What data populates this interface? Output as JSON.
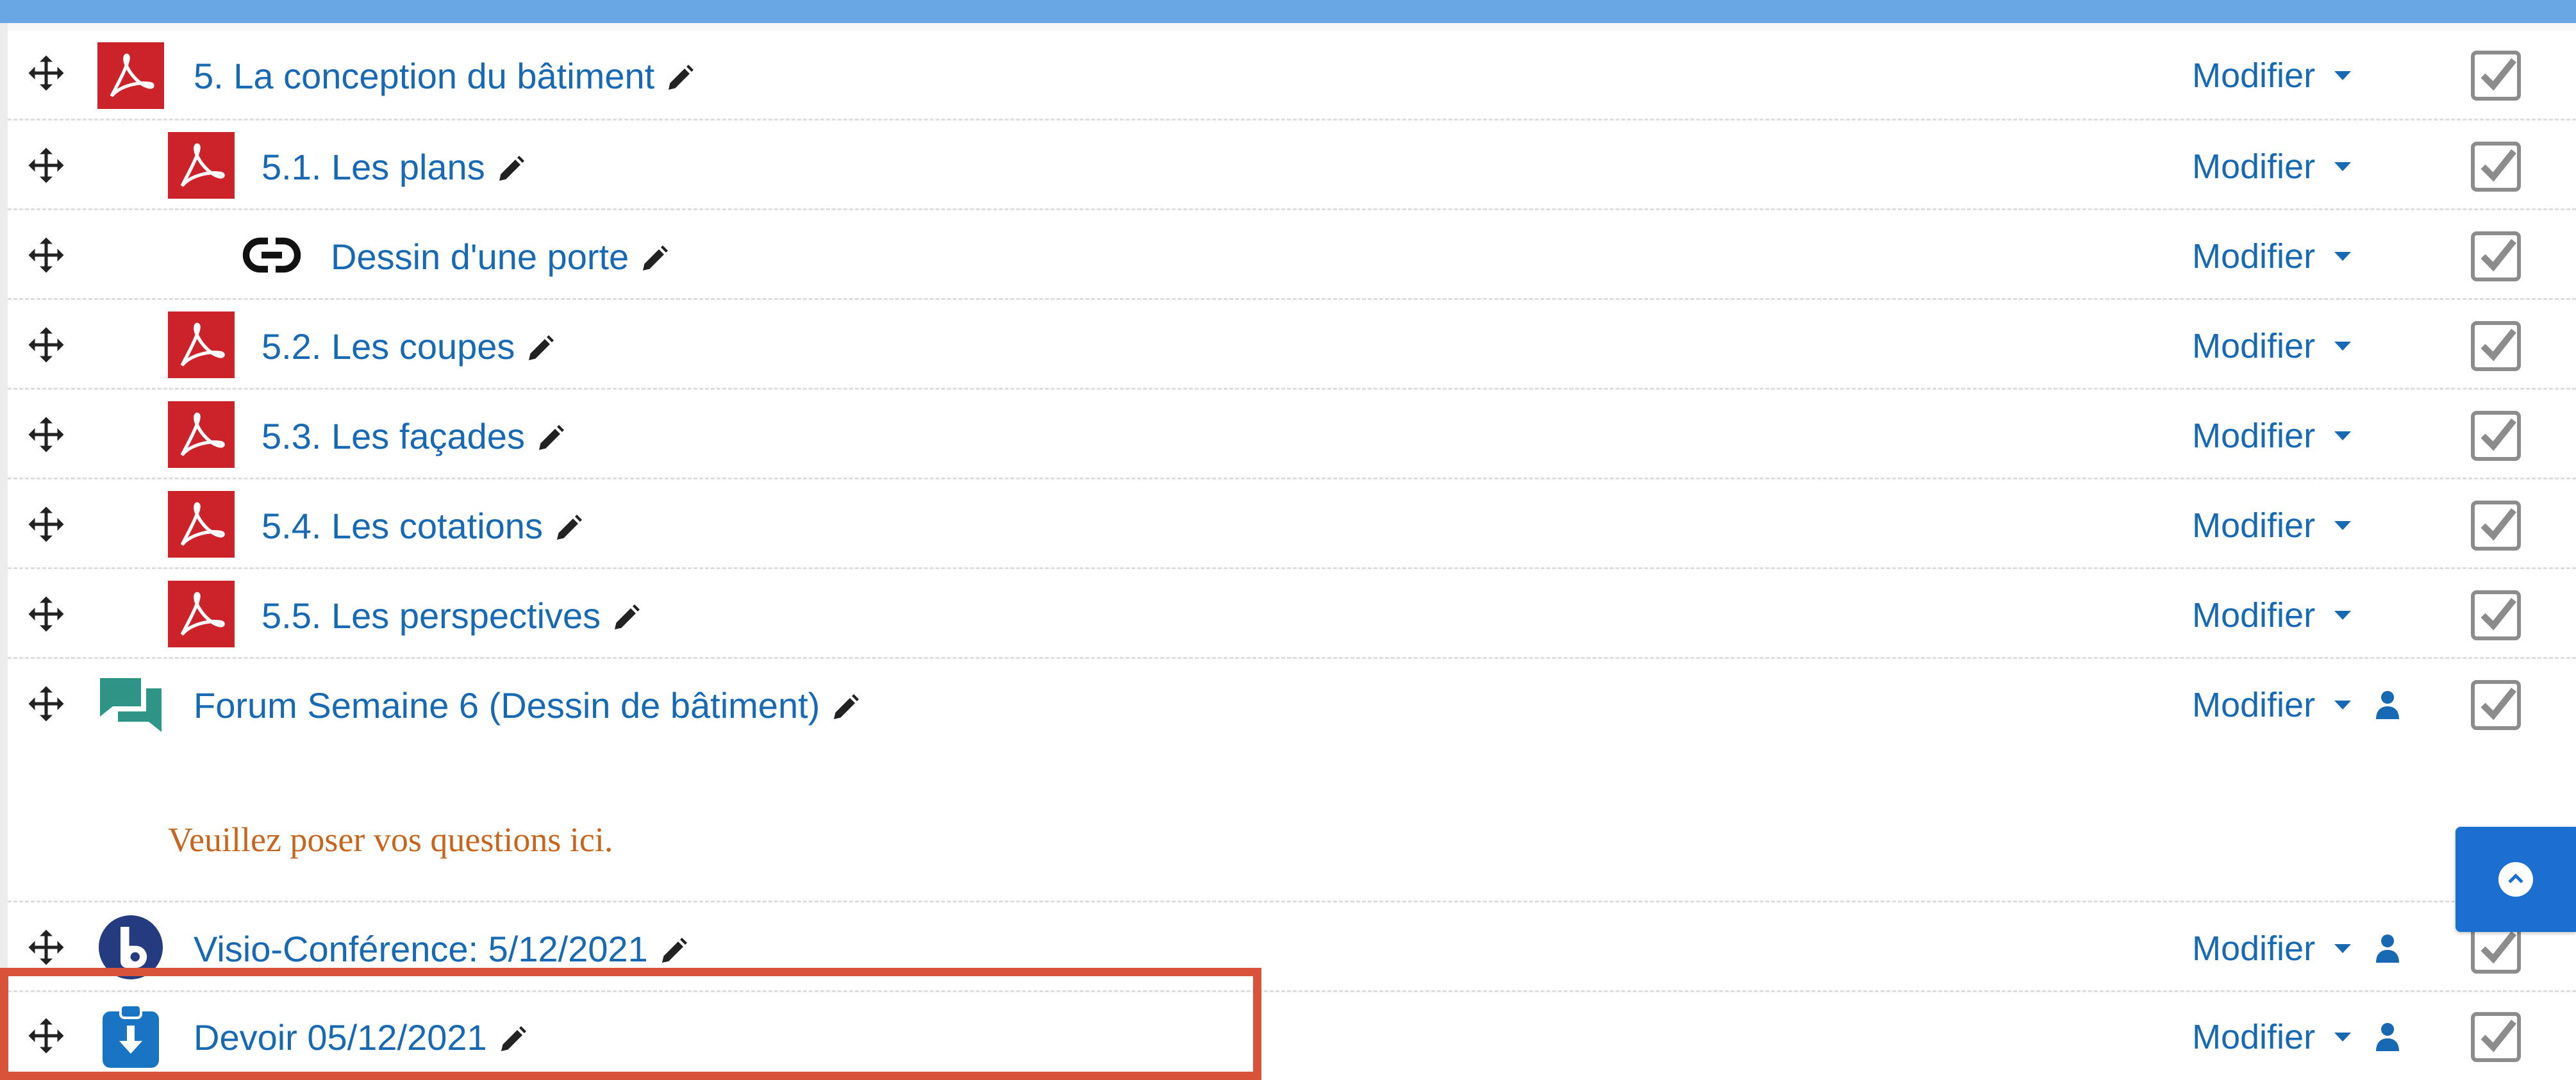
{
  "colors": {
    "accent": "#1769b4",
    "pdf_red": "#cc2229",
    "forum_teal": "#2e9486",
    "assign_blue": "#1a74c4",
    "highlight": "#d9533b",
    "desc_orange": "#c8651c"
  },
  "activities": [
    {
      "title": "5. La conception du bâtiment",
      "type": "pdf",
      "action_label": "Modifier",
      "has_user_icon": false
    },
    {
      "title": "5.1. Les plans",
      "type": "pdf",
      "action_label": "Modifier",
      "has_user_icon": false
    },
    {
      "title": "Dessin d'une porte",
      "type": "url-link",
      "action_label": "Modifier",
      "has_user_icon": false
    },
    {
      "title": "5.2. Les coupes",
      "type": "pdf",
      "action_label": "Modifier",
      "has_user_icon": false
    },
    {
      "title": "5.3. Les façades",
      "type": "pdf",
      "action_label": "Modifier",
      "has_user_icon": false
    },
    {
      "title": "5.4. Les cotations",
      "type": "pdf",
      "action_label": "Modifier",
      "has_user_icon": false
    },
    {
      "title": "5.5. Les perspectives",
      "type": "pdf",
      "action_label": "Modifier",
      "has_user_icon": false
    },
    {
      "title": "Forum Semaine 6 (Dessin de bâtiment)",
      "type": "forum",
      "action_label": "Modifier",
      "has_user_icon": true,
      "description": "Veuillez poser vos questions ici."
    },
    {
      "title": "Visio-Conférence: 5/12/2021",
      "type": "bigbluebutton",
      "action_label": "Modifier",
      "has_user_icon": true
    },
    {
      "title": "Devoir 05/12/2021",
      "type": "assignment",
      "action_label": "Modifier",
      "has_user_icon": true,
      "highlighted": true
    }
  ],
  "icons": {
    "move": "move-arrows-icon",
    "edit": "pencil-icon",
    "completion": "checkbox-icon",
    "user": "user-icon",
    "scroll_top": "chevron-up-icon"
  }
}
